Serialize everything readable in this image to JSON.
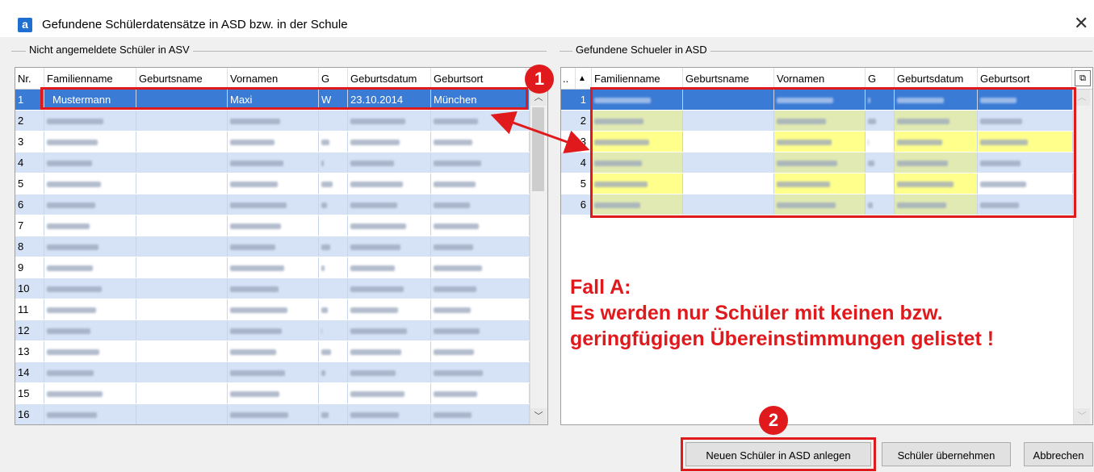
{
  "window": {
    "icon_letter": "a",
    "title": "Gefundene Schülerdatensätze in ASD bzw. in der Schule",
    "close_glyph": "✕"
  },
  "left_group": {
    "label": "Nicht angemeldete Schüler in ASV",
    "columns": [
      "Nr.",
      "Familienname",
      "Geburtsname",
      "Vornamen",
      "G",
      "Geburtsdatum",
      "Geburtsort"
    ],
    "selected_row": {
      "nr": "1",
      "familienname": "Mustermann",
      "geburtsname": "",
      "vornamen": "Maxi",
      "g": "W",
      "geburtsdatum": "23.10.2014",
      "geburtsort": "München"
    },
    "row_numbers": [
      "2",
      "3",
      "4",
      "5",
      "6",
      "7",
      "8",
      "9",
      "10",
      "11",
      "12",
      "13",
      "14",
      "15",
      "16"
    ]
  },
  "right_group": {
    "label": "Gefundene Schueler in ASD",
    "sort_glyph": "..",
    "sort_arrow": "▲",
    "columns": [
      "Familienname",
      "Geburtsname",
      "Vornamen",
      "G",
      "Geburtsdatum",
      "Geburtsort"
    ],
    "row_numbers": [
      "1",
      "2",
      "3",
      "4",
      "5",
      "6"
    ]
  },
  "annotations": {
    "badge_1": "1",
    "badge_2": "2",
    "note_line1": "Fall A:",
    "note_line2": "Es werden nur Schüler mit keinen bzw.",
    "note_line3": "geringfügigen Übereinstimmungen gelistet !"
  },
  "buttons": {
    "new_student": "Neuen Schüler in ASD anlegen",
    "adopt": "Schüler übernehmen",
    "cancel": "Abbrechen"
  },
  "colors": {
    "accent_red": "#e0191c",
    "selection_blue": "#3a7bd5",
    "row_alt": "#d6e2f5",
    "highlight_yellow": "#ffff78"
  }
}
